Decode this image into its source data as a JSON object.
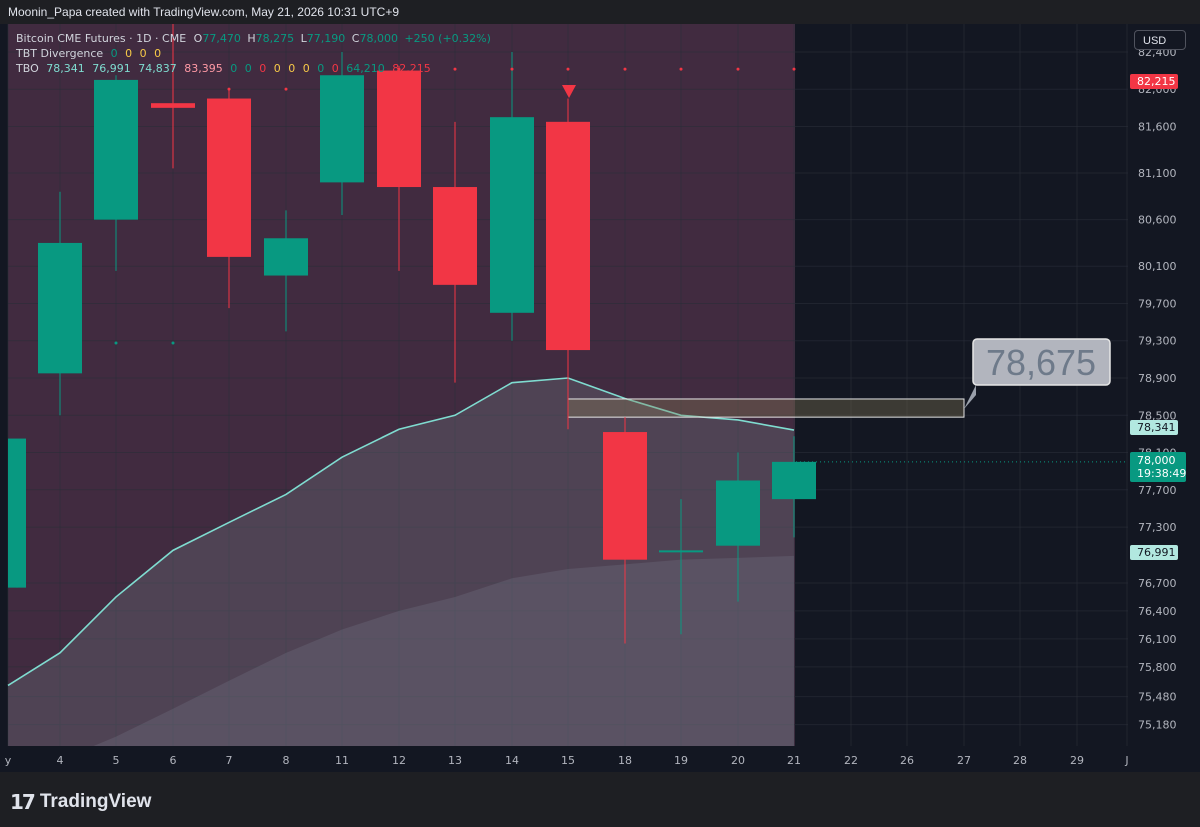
{
  "header": {
    "attribution": "Moonin_Papa created with TradingView.com, May 21, 2026 10:31 UTC+9"
  },
  "legend": {
    "symbol": "Bitcoin CME Futures · 1D · CME",
    "open_label": "O",
    "open": "77,470",
    "high_label": "H",
    "high": "78,275",
    "low_label": "L",
    "low": "77,190",
    "close_label": "C",
    "close": "78,000",
    "change": "+250 (+0.32%)",
    "tbt_name": "TBT Divergence",
    "tbt_values": [
      "0",
      "0",
      "0",
      "0"
    ],
    "tbo_name": "TBO",
    "tbo_values": [
      "78,341",
      "76,991",
      "74,837",
      "83,395",
      "0",
      "0",
      "0",
      "0",
      "0",
      "0",
      "0",
      "0",
      "64,210",
      "82,215"
    ]
  },
  "currency_button": "USD",
  "price_axis": {
    "ticks": [
      "82,400",
      "82,000",
      "81,600",
      "81,100",
      "80,600",
      "80,100",
      "79,700",
      "79,300",
      "78,900",
      "78,500",
      "78,100",
      "77,700",
      "77,300",
      "76,700",
      "76,400",
      "76,100",
      "75,800",
      "75,480",
      "75,180"
    ],
    "labels": {
      "upper_band": "82,215",
      "tbo_fast": "78,341",
      "last_price": "78,000",
      "countdown": "19:38:49",
      "tbo_slow": "76,991"
    }
  },
  "time_axis": {
    "ticks": [
      "y",
      "4",
      "5",
      "6",
      "7",
      "8",
      "11",
      "12",
      "13",
      "14",
      "15",
      "18",
      "19",
      "20",
      "21",
      "22",
      "26",
      "27",
      "28",
      "29",
      "J"
    ]
  },
  "annotation": {
    "callout_text": "78,675",
    "zone_top": 78675,
    "zone_bottom": 78480
  },
  "colors": {
    "up": "#089981",
    "down": "#f23645",
    "band_line": "#7fdcd0",
    "background": "#131722",
    "shade": "#4a2f45"
  },
  "chart_data": {
    "type": "candlestick",
    "x": [
      "4",
      "5",
      "6",
      "7",
      "8",
      "11",
      "12",
      "13",
      "14",
      "15",
      "18",
      "19",
      "20",
      "21"
    ],
    "ohlc": [
      [
        78950,
        80900,
        78500,
        80350
      ],
      [
        80600,
        82150,
        80050,
        82100
      ],
      [
        81850,
        83400,
        81150,
        81800
      ],
      [
        81900,
        82000,
        79650,
        80200
      ],
      [
        80000,
        80700,
        79400,
        80400
      ],
      [
        81000,
        82400,
        80650,
        82150
      ],
      [
        82200,
        82250,
        80050,
        80950
      ],
      [
        80950,
        81650,
        78850,
        79900
      ],
      [
        79600,
        82400,
        79300,
        81700
      ],
      [
        81650,
        81900,
        78350,
        79200
      ],
      [
        78320,
        78480,
        76050,
        76950
      ],
      [
        77050,
        77600,
        76150,
        77050
      ],
      [
        77100,
        78100,
        76500,
        77800
      ],
      [
        77600,
        78275,
        77190,
        78000
      ]
    ],
    "partial_first_candle": [
      76650,
      78200,
      76650,
      78250
    ],
    "tbo_fast_line": [
      75600,
      75950,
      76550,
      77050,
      77350,
      77650,
      78050,
      78350,
      78500,
      78850,
      78900,
      78680,
      78500,
      78450,
      78341
    ],
    "tbo_slow_line": [
      74800,
      75050,
      75350,
      75650,
      75950,
      76200,
      76400,
      76550,
      76750,
      76850,
      76900,
      76950,
      76970,
      76991
    ],
    "upper_band": 82215,
    "sell_signal_at": "15",
    "ylim": [
      74950,
      82700
    ]
  }
}
